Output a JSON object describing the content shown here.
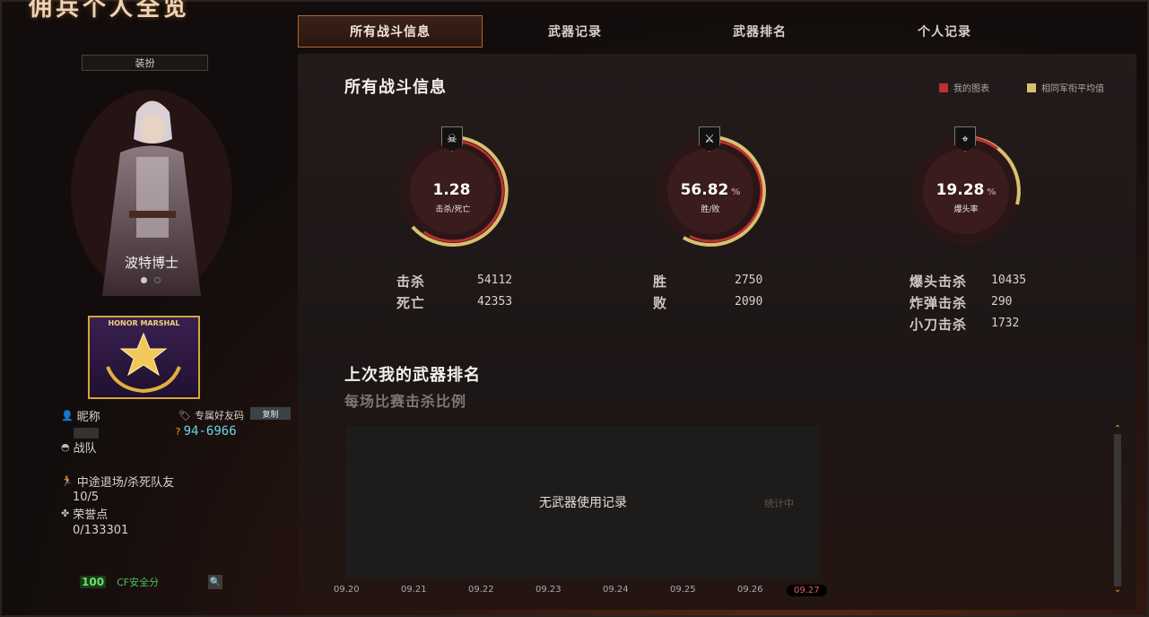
{
  "header": {
    "title": "佣兵个人全览"
  },
  "tabs": [
    {
      "label": "所有战斗信息",
      "active": true
    },
    {
      "label": "武器记录",
      "active": false
    },
    {
      "label": "武器排名",
      "active": false
    },
    {
      "label": "个人记录",
      "active": false
    }
  ],
  "left": {
    "dress_button": "装扮",
    "character_name": "波特博士",
    "badge_text": "HONOR MARSHAL",
    "nickname_label": "昵称",
    "friend_code_label": "专属好友码",
    "copy_button": "复制",
    "friend_code": "94-6966",
    "team_label": "战队",
    "quit_kill_label": "中途退场/杀死队友",
    "quit_kill_value": "10/5",
    "honor_label": "荣誉点",
    "honor_value": "0/133301",
    "safety_score": "100",
    "safety_label": "CF安全分"
  },
  "main": {
    "title": "所有战斗信息",
    "legend_mine": "我的图表",
    "legend_avg": "相同军衔平均值",
    "legend_colors": {
      "mine": "#c03030",
      "avg": "#d8c070"
    },
    "gauges": [
      {
        "icon": "skull-icon",
        "value": "1.28",
        "unit": "",
        "label": "击杀/死亡"
      },
      {
        "icon": "crossed-swords-icon",
        "value": "56.82",
        "unit": "%",
        "label": "胜/败"
      },
      {
        "icon": "crosshair-icon",
        "value": "19.28",
        "unit": "%",
        "label": "爆头率"
      }
    ],
    "stats": {
      "kills_label": "击杀",
      "kills": "54112",
      "deaths_label": "死亡",
      "deaths": "42353",
      "wins_label": "胜",
      "wins": "2750",
      "losses_label": "败",
      "losses": "2090",
      "headshot_label": "爆头击杀",
      "headshot": "10435",
      "grenade_label": "炸弹击杀",
      "grenade": "290",
      "knife_label": "小刀击杀",
      "knife": "1732"
    },
    "weapon_rank_title": "上次我的武器排名",
    "weapon_rank_sub": "每场比赛击杀比例",
    "empty_message": "无武器使用记录",
    "counting": "统计中",
    "dates": [
      "09.20",
      "09.21",
      "09.22",
      "09.23",
      "09.24",
      "09.25",
      "09.26",
      "09.27"
    ],
    "active_date": "09.27"
  }
}
